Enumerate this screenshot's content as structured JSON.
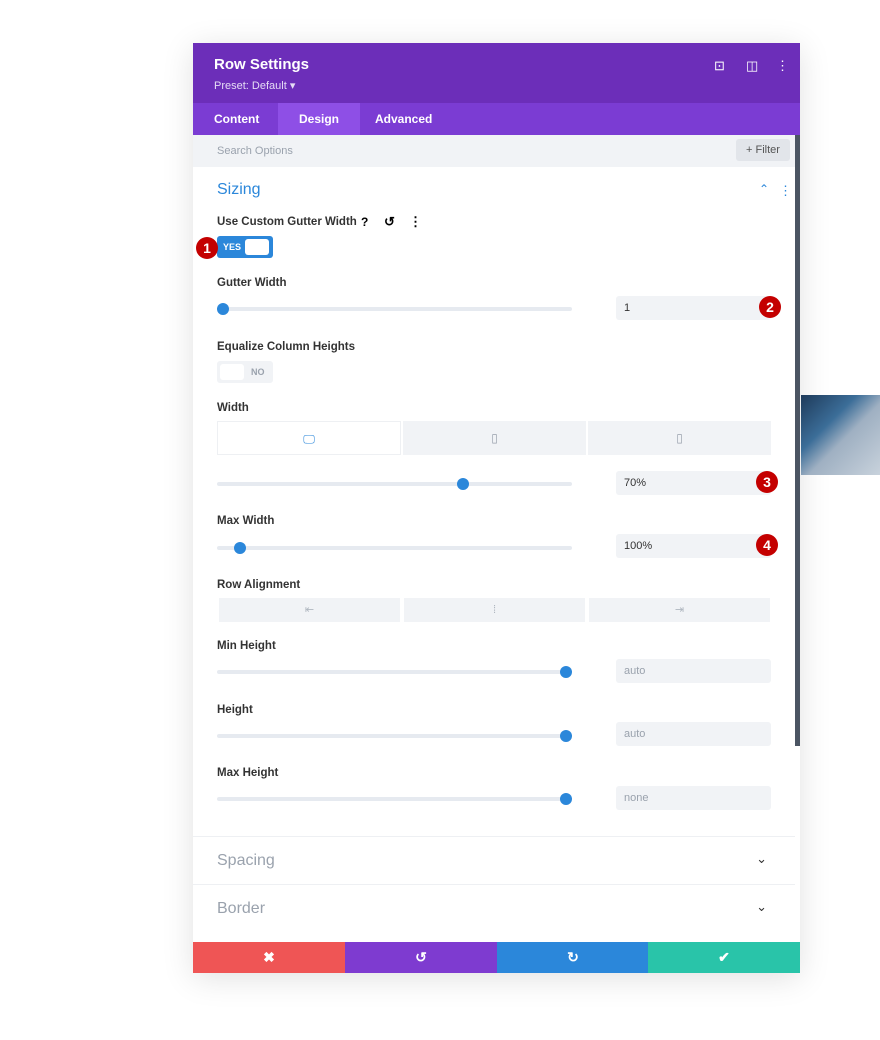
{
  "header": {
    "title": "Row Settings",
    "preset": "Preset: Default ▾"
  },
  "tabs": [
    "Content",
    "Design",
    "Advanced"
  ],
  "search": {
    "placeholder": "Search Options",
    "filter": "+ Filter"
  },
  "sizing": {
    "title": "Sizing",
    "gutter_toggle": {
      "label": "Use Custom Gutter Width",
      "state": "YES"
    },
    "gutter_width": {
      "label": "Gutter Width",
      "value": "1",
      "slider": 0
    },
    "equalize": {
      "label": "Equalize Column Heights",
      "state": "NO"
    },
    "width": {
      "label": "Width",
      "value": "70%",
      "slider": 0.7
    },
    "max_width": {
      "label": "Max Width",
      "value": "100%",
      "slider": 0.05
    },
    "row_alignment": {
      "label": "Row Alignment"
    },
    "min_height": {
      "label": "Min Height",
      "value": "auto",
      "slider": 1
    },
    "height": {
      "label": "Height",
      "value": "auto",
      "slider": 1
    },
    "max_height": {
      "label": "Max Height",
      "value": "none",
      "slider": 1
    }
  },
  "sections": [
    "Spacing",
    "Border"
  ],
  "badges": [
    "1",
    "2",
    "3",
    "4"
  ],
  "colors": {
    "header": "#6c2eb9",
    "tabs": "#7b3cd3",
    "accent": "#2b87da",
    "cancel": "#ef5555",
    "undo": "#7e3bd0",
    "redo": "#2b87da",
    "save": "#29c4a9",
    "badge": "#c40000"
  }
}
